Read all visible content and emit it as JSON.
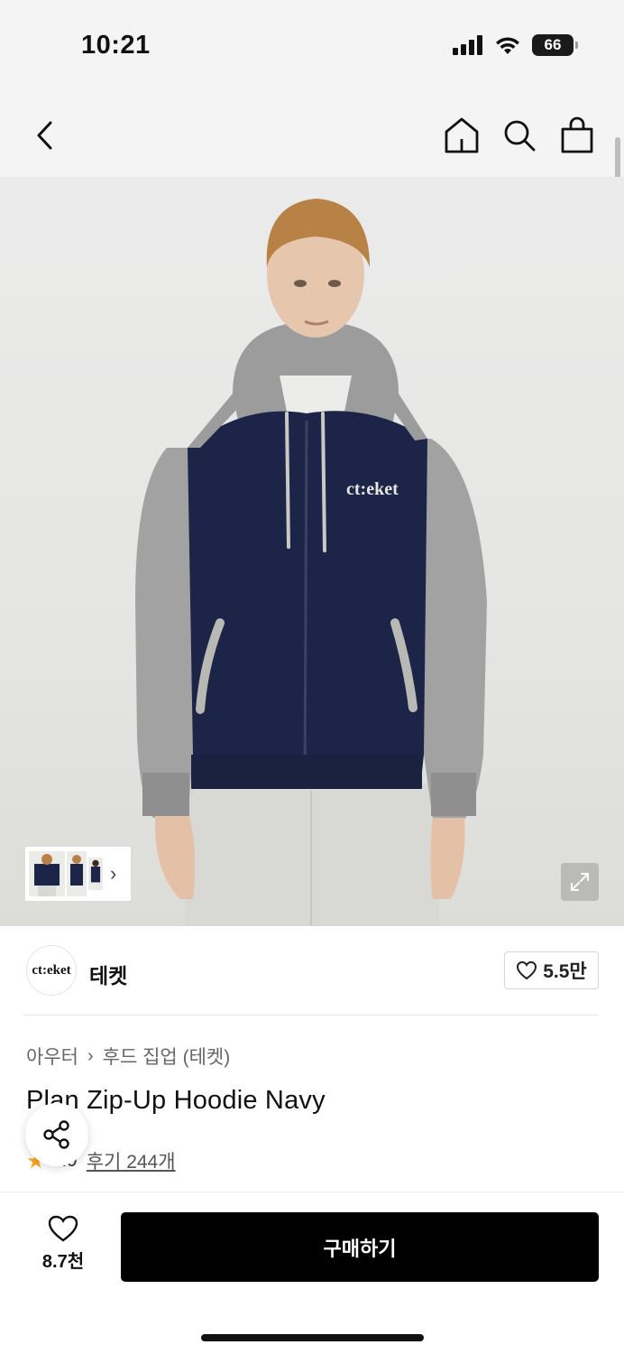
{
  "status_bar": {
    "time": "10:21",
    "battery": "66"
  },
  "nav": {
    "back_icon": "chevron-left-icon",
    "home_icon": "home-icon",
    "search_icon": "search-icon",
    "bag_icon": "shopping-bag-icon"
  },
  "gallery": {
    "expand_icon": "expand-icon",
    "thumb_chevron": "›"
  },
  "brand": {
    "logo_text": "ct:eket",
    "name": "테켓",
    "likes": "5.5만"
  },
  "product": {
    "breadcrumb": [
      "아우터",
      "후드 집업 (테켓)"
    ],
    "breadcrumb_sep": "›",
    "title": "Plan Zip-Up Hoodie Navy",
    "rating": "4.9",
    "star": "★",
    "reviews": "후기 244개"
  },
  "bottom": {
    "wish_count": "8.7천",
    "buy_label": "구매하기"
  },
  "colors": {
    "accent_star": "#f5a623",
    "buy_button": "#000000",
    "navy_hoodie": "#1c2547",
    "grey_sleeve": "#9a9a9a"
  }
}
